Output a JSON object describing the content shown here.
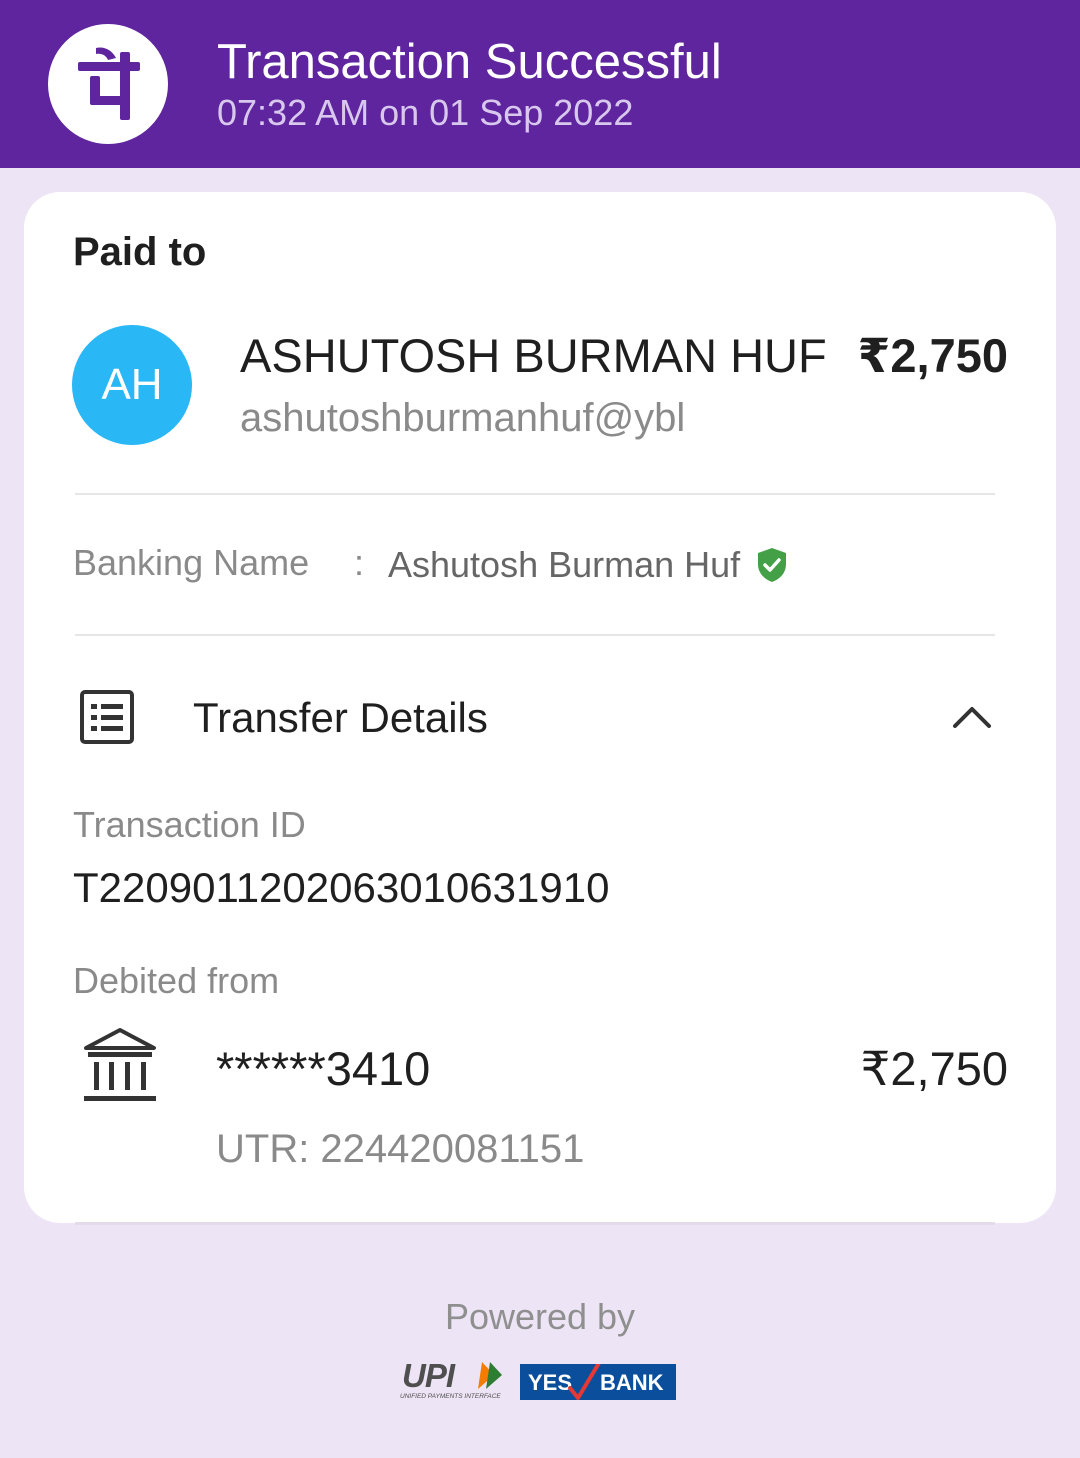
{
  "header": {
    "logo_icon": "phonepe-logo-icon",
    "title": "Transaction Successful",
    "subtitle": "07:32 AM on 01 Sep 2022",
    "background_color": "#5f259f"
  },
  "payment": {
    "section_label": "Paid to",
    "avatar_initials": "AH",
    "avatar_color": "#2ab7f6",
    "payee_name": "ASHUTOSH BURMAN HUF",
    "payee_upi_id": "ashutoshburmanhuf@ybl",
    "amount": "₹2,750",
    "banking_name_label": "Banking Name",
    "banking_name_separator": ":",
    "banking_name_value": "Ashutosh Burman Huf",
    "verified_icon": "verified-shield-icon",
    "verified_color": "#43a047"
  },
  "transfer_details": {
    "icon": "list-document-icon",
    "title": "Transfer Details",
    "toggle_icon": "chevron-up-icon",
    "transaction_id_label": "Transaction ID",
    "transaction_id_value": "T2209011202063010631910",
    "debited_from_label": "Debited from",
    "bank_icon": "bank-building-icon",
    "account_number": "******3410",
    "debited_amount": "₹2,750",
    "utr": "UTR: 224420081151"
  },
  "footer": {
    "powered_by": "Powered by",
    "upi_logo_text": "UPI",
    "upi_tagline": "UNIFIED PAYMENTS INTERFACE",
    "bank_logo_left": "YES",
    "bank_logo_right": "BANK"
  }
}
